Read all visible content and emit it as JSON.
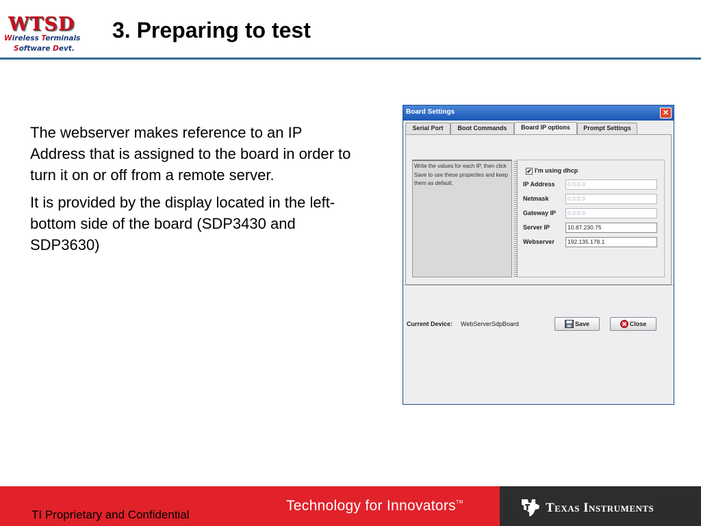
{
  "header": {
    "logo_mark": "WTSD",
    "logo_line1": {
      "w1_cap": "W",
      "w1_rest": "ireless ",
      "w2_cap": "T",
      "w2_rest": "erminals"
    },
    "logo_line2": {
      "w1_cap": "S",
      "w1_rest": "oftware ",
      "w2_cap": "D",
      "w2_rest": "evt."
    },
    "title": "3. Preparing to test"
  },
  "body": {
    "paragraphs": [
      "The webserver makes reference to an IP Address that is assigned to the board in order to turn it on or off from a remote server.",
      "It is provided by the display located in the left-bottom side of the board (SDP3430 and SDP3630)"
    ]
  },
  "dialog": {
    "title": "Board Settings",
    "close_glyph": "✕",
    "tabs": [
      {
        "label": "Serial Port",
        "active": false
      },
      {
        "label": "Boot Commands",
        "active": false
      },
      {
        "label": "Board IP options",
        "active": true
      },
      {
        "label": "Prompt Settings",
        "active": false
      }
    ],
    "info_text": "Write the values for each IP, then click Save to use these properties and keep them as default.",
    "dhcp": {
      "label": "I'm using dhcp",
      "checked": true,
      "check_glyph": "✔"
    },
    "fields": [
      {
        "label": "IP Address",
        "value": "0.0.0.0",
        "disabled": true
      },
      {
        "label": "Netmask",
        "value": "0.0.0.0",
        "disabled": true
      },
      {
        "label": "Gateway IP",
        "value": "0.0.0.0",
        "disabled": true
      },
      {
        "label": "Server IP",
        "value": "10.87.230.75",
        "disabled": false
      },
      {
        "label": "Webserver",
        "value": "192.135.178.1",
        "disabled": false
      }
    ],
    "current_device_label": "Current Device:",
    "current_device_value": "WebServerSdpBoard",
    "save_label": "Save",
    "close_label": "Close"
  },
  "footer": {
    "confidential": "TI Proprietary and Confidential",
    "slogan": "Technology for Innovators",
    "slogan_tm": "TM",
    "company": "Texas Instruments"
  },
  "colors": {
    "brand_red": "#e1222b",
    "header_rule": "#2f6a94",
    "titlebar_blue": "#1a56b4"
  }
}
